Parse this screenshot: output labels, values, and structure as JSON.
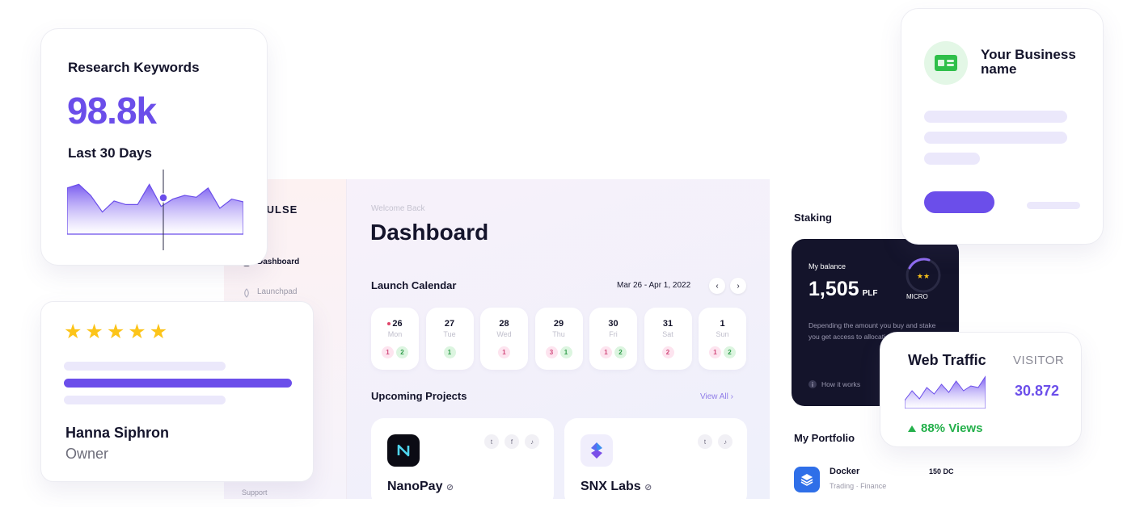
{
  "dashboard": {
    "logo": "PULSE",
    "nav": [
      {
        "label": "Dashboard",
        "icon": "dashboard-icon",
        "active": true
      },
      {
        "label": "Launchpad",
        "icon": "rocket-icon",
        "active": false
      }
    ],
    "support_label": "Support",
    "welcome": "Welcome Back",
    "title": "Dashboard",
    "launch_calendar": {
      "title": "Launch Calendar",
      "range": "Mar 26 - Apr 1, 2022",
      "prev_icon": "chevron-left-icon",
      "next_icon": "chevron-right-icon",
      "days": [
        {
          "num": "26",
          "dow": "Mon",
          "chips": [
            "1",
            "2"
          ],
          "today": true
        },
        {
          "num": "27",
          "dow": "Tue",
          "chips": [
            "1"
          ]
        },
        {
          "num": "28",
          "dow": "Wed",
          "chips": [
            "1"
          ]
        },
        {
          "num": "29",
          "dow": "Thu",
          "chips": [
            "3",
            "1"
          ]
        },
        {
          "num": "30",
          "dow": "Fri",
          "chips": [
            "1",
            "2"
          ]
        },
        {
          "num": "31",
          "dow": "Sat",
          "chips": [
            "2"
          ]
        },
        {
          "num": "1",
          "dow": "Sun",
          "chips": [
            "1",
            "2"
          ]
        }
      ]
    },
    "upcoming": {
      "title": "Upcoming Projects",
      "view_all": "View All",
      "projects": [
        {
          "name": "NanoPay",
          "socials": [
            "twitter-icon",
            "facebook-icon",
            "tiktok-icon"
          ]
        },
        {
          "name": "SNX Labs",
          "socials": [
            "twitter-icon",
            "tiktok-icon"
          ]
        }
      ]
    },
    "staking": {
      "title": "Staking",
      "balance_label": "My balance",
      "balance_value": "1,505",
      "balance_unit": "PLF",
      "tier": "MICRO",
      "description": "Depending the amount you buy and stake you get access to allocation sizes.",
      "how_it_works": "How it works"
    },
    "portfolio": {
      "title": "My Portfolio",
      "items": [
        {
          "name": "Docker",
          "tags": "Trading · Finance",
          "amount": "150 DC"
        }
      ]
    }
  },
  "research_card": {
    "title": "Research Keywords",
    "value": "98.8k",
    "period": "Last 30 Days",
    "sparkline": [
      70,
      66,
      78,
      96,
      84,
      88,
      88,
      66,
      90,
      82,
      78,
      80,
      70,
      92,
      82,
      85
    ]
  },
  "review_card": {
    "stars": 5,
    "name": "Hanna Siphron",
    "role": "Owner"
  },
  "business_card": {
    "name": "Your Business name",
    "icon": "id-card-icon"
  },
  "traffic_card": {
    "title": "Web Traffic",
    "visitor_label": "VISITOR",
    "visitor_value": "30.872",
    "views": "88% Views",
    "sparkline": [
      10,
      22,
      12,
      26,
      18,
      30,
      20,
      34,
      22,
      28,
      26,
      40
    ]
  },
  "colors": {
    "accent": "#6b4eea",
    "dark": "#14142b",
    "positive": "#24b04b",
    "star": "#fcc419"
  }
}
